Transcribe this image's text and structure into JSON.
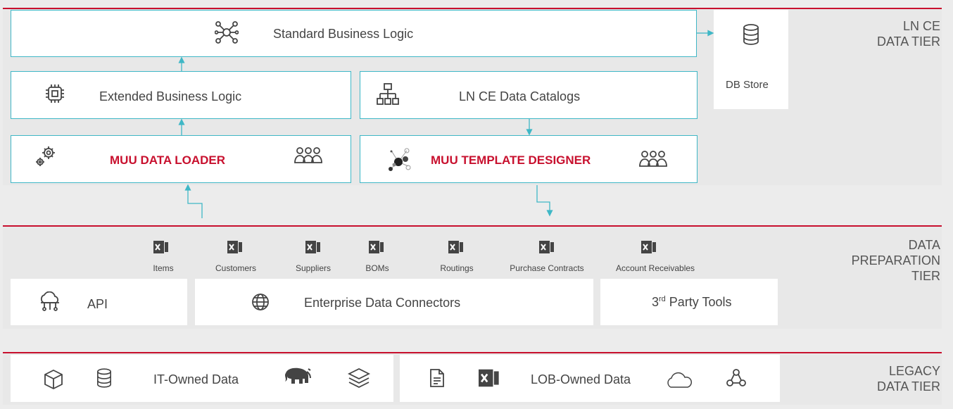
{
  "tiers": {
    "ln_ce": [
      "LN CE",
      "DATA TIER"
    ],
    "prep": [
      "DATA",
      "PREPARATION",
      "TIER"
    ],
    "legacy": [
      "LEGACY",
      "DATA TIER"
    ]
  },
  "ln_ce": {
    "standard": "Standard Business Logic",
    "extended": "Extended Business Logic",
    "catalogs": "LN CE Data Catalogs",
    "loader": "MUU DATA LOADER",
    "designer": "MUU TEMPLATE DESIGNER",
    "db_store": "DB Store"
  },
  "prep": {
    "files": [
      "Items",
      "Customers",
      "Suppliers",
      "BOMs",
      "Routings",
      "Purchase Contracts",
      "Account Receivables"
    ],
    "api": "API",
    "connectors": "Enterprise Data Connectors",
    "third_party_num": "3",
    "third_party_sup": "rd",
    "third_party_rest": " Party Tools"
  },
  "legacy": {
    "it_owned": "IT-Owned Data",
    "lob_owned": "LOB-Owned Data"
  },
  "colors": {
    "accent": "#c8102e",
    "connector": "#3fb7c6"
  }
}
